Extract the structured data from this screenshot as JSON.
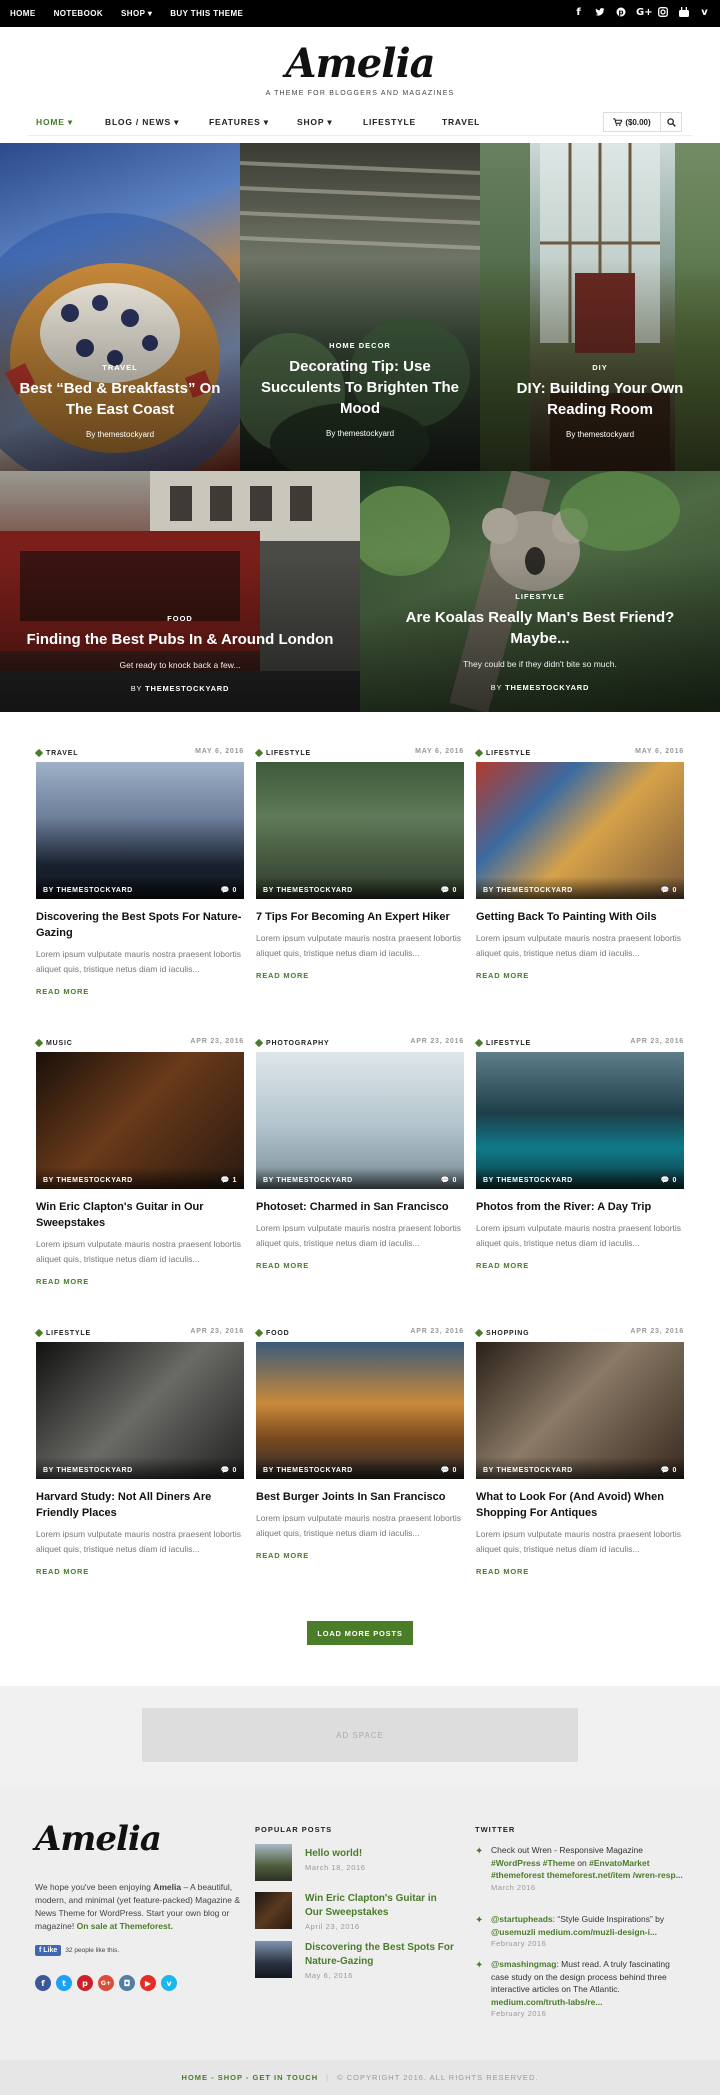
{
  "topbar": {
    "nav": [
      "HOME",
      "NOTEBOOK",
      "SHOP",
      "BUY THIS THEME"
    ],
    "social": [
      "f",
      "t",
      "p",
      "G+",
      "ig",
      "yt",
      "v"
    ]
  },
  "brand": {
    "logo": "Amelia",
    "tagline": "A THEME FOR BLOGGERS AND MAGAZINES"
  },
  "mainnav": {
    "items": [
      "HOME",
      "BLOG / NEWS",
      "FEATURES",
      "SHOP",
      "LIFESTYLE",
      "TRAVEL"
    ],
    "cart": "($0.00)"
  },
  "hero": [
    {
      "cat": "TRAVEL",
      "title": "Best “Bed & Breakfasts” On The East Coast",
      "by": "By themestockyard"
    },
    {
      "cat": "HOME DECOR",
      "title": "Decorating Tip: Use Succulents To Brighten The Mood",
      "by": "By themestockyard"
    },
    {
      "cat": "DIY",
      "title": "DIY: Building Your Own Reading Room",
      "by": "By themestockyard"
    },
    {
      "cat": "FOOD",
      "title": "Finding the Best Pubs In & Around London",
      "excerpt": "Get ready to knock back a few...",
      "by_prefix": "BY",
      "by": "THEMESTOCKYARD"
    },
    {
      "cat": "LIFESTYLE",
      "title": "Are Koalas Really Man's Best Friend? Maybe...",
      "excerpt": "They could be if they didn't bite so much.",
      "by_prefix": "BY",
      "by": "THEMESTOCKYARD"
    }
  ],
  "posts": [
    {
      "cat": "TRAVEL",
      "date": "MAY 6, 2016",
      "title": "Discovering the Best Spots For Nature-Gazing",
      "comments": "0"
    },
    {
      "cat": "LIFESTYLE",
      "date": "MAY 6, 2016",
      "title": "7 Tips For Becoming An Expert Hiker",
      "comments": "0"
    },
    {
      "cat": "LIFESTYLE",
      "date": "MAY 6, 2016",
      "title": "Getting Back To Painting With Oils",
      "comments": "0"
    },
    {
      "cat": "MUSIC",
      "date": "APR 23, 2016",
      "title": "Win Eric Clapton's Guitar in Our Sweepstakes",
      "comments": "1"
    },
    {
      "cat": "PHOTOGRAPHY",
      "date": "APR 23, 2016",
      "title": "Photoset: Charmed in San Francisco",
      "comments": "0"
    },
    {
      "cat": "LIFESTYLE",
      "date": "APR 23, 2016",
      "title": "Photos from the River: A Day Trip",
      "comments": "0"
    },
    {
      "cat": "LIFESTYLE",
      "date": "APR 23, 2016",
      "title": "Harvard Study: Not All Diners Are Friendly Places",
      "comments": "0"
    },
    {
      "cat": "FOOD",
      "date": "APR 23, 2016",
      "title": "Best Burger Joints In San Francisco",
      "comments": "0"
    },
    {
      "cat": "SHOPPING",
      "date": "APR 23, 2016",
      "title": "What to Look For (And Avoid) When Shopping For Antiques",
      "comments": "0"
    }
  ],
  "post_common": {
    "by": "BY THEMESTOCKYARD",
    "excerpt": "Lorem ipsum vulputate mauris nostra praesent lobortis aliquet quis, tristique netus diam id iaculis...",
    "readmore": "READ MORE"
  },
  "loadmore": "LOAD MORE POSTS",
  "ad": "AD SPACE",
  "footer": {
    "logo": "Amelia",
    "about_1": "We hope you've been enjoying ",
    "about_brand": "Amelia",
    "about_2": " – A beautiful, modern, and minimal (yet feature-packed) Magazine & News Theme for WordPress. Start your own blog or magazine! ",
    "about_link": "On sale at Themeforest.",
    "fb_like": "Like",
    "fb_count": "32 people like this.",
    "popular_head": "POPULAR POSTS",
    "popular": [
      {
        "title": "Hello world!",
        "date": "March 18, 2016"
      },
      {
        "title": "Win Eric Clapton's Guitar in Our Sweepstakes",
        "date": "April 23, 2016"
      },
      {
        "title": "Discovering the Best Spots For Nature-Gazing",
        "date": "May 6, 2016"
      }
    ],
    "twitter_head": "TWITTER",
    "tweets": [
      {
        "html": "Check out Wren - Responsive Magazine <b>#WordPress #Theme</b> on <b>#EnvatoMarket #themeforest themeforest.net/item /wren-resp...</b>",
        "date": "March 2016"
      },
      {
        "html": "<b>@startupheads</b>: “Style Guide Inspirations” by <b>@usemuzli medium.com/muzli-design-i...</b>",
        "date": "February 2016"
      },
      {
        "html": "<b>@smashingmag</b>: Must read. A truly fascinating case study on the design process behind three interactive articles on The Atlantic. <b>medium.com/truth-labs/re...</b>",
        "date": "February 2016"
      }
    ],
    "bottom_links": "HOME - SHOP - GET IN TOUCH",
    "copyright": "© COPYRIGHT 2016. ALL RIGHTS RESERVED.",
    "colors": {
      "accent": "#4a7c2a"
    }
  }
}
